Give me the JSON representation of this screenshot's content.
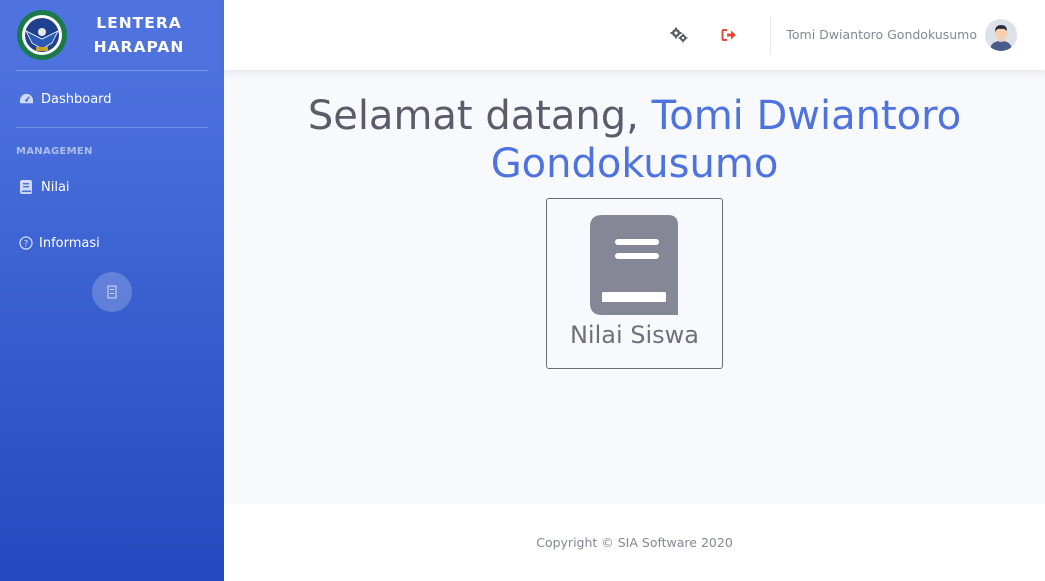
{
  "sidebar": {
    "brand": {
      "line1": "LENTERA",
      "line2": "HARAPAN",
      "logo_icon": "eagle-emblem-icon"
    },
    "items": [
      {
        "label": "Dashboard",
        "icon": "tachometer-icon"
      },
      {
        "label": "Nilai",
        "icon": "book-icon"
      },
      {
        "label": "Informasi",
        "icon": "question-circle-icon"
      }
    ],
    "heading": "MANAGEMEN",
    "toggle_icon": "sidebar-toggle-icon"
  },
  "topbar": {
    "settings_icon": "gears-icon",
    "logout_icon": "sign-out-icon",
    "user_name": "Tomi Dwiantoro Gondokusumo"
  },
  "main": {
    "greeting": "Selamat datang,",
    "user_name": "Tomi Dwiantoro Gondokusumo",
    "card_label": "Nilai Siswa",
    "card_icon": "book-icon"
  },
  "footer": {
    "copyright": "Copyright © SIA Software 2020"
  },
  "colors": {
    "primary": "#4e73df",
    "sidebar_gradient_end": "#224abe",
    "logout_red": "#e74a3b",
    "text_gray": "#5a5c69",
    "muted_gray": "#858796"
  }
}
